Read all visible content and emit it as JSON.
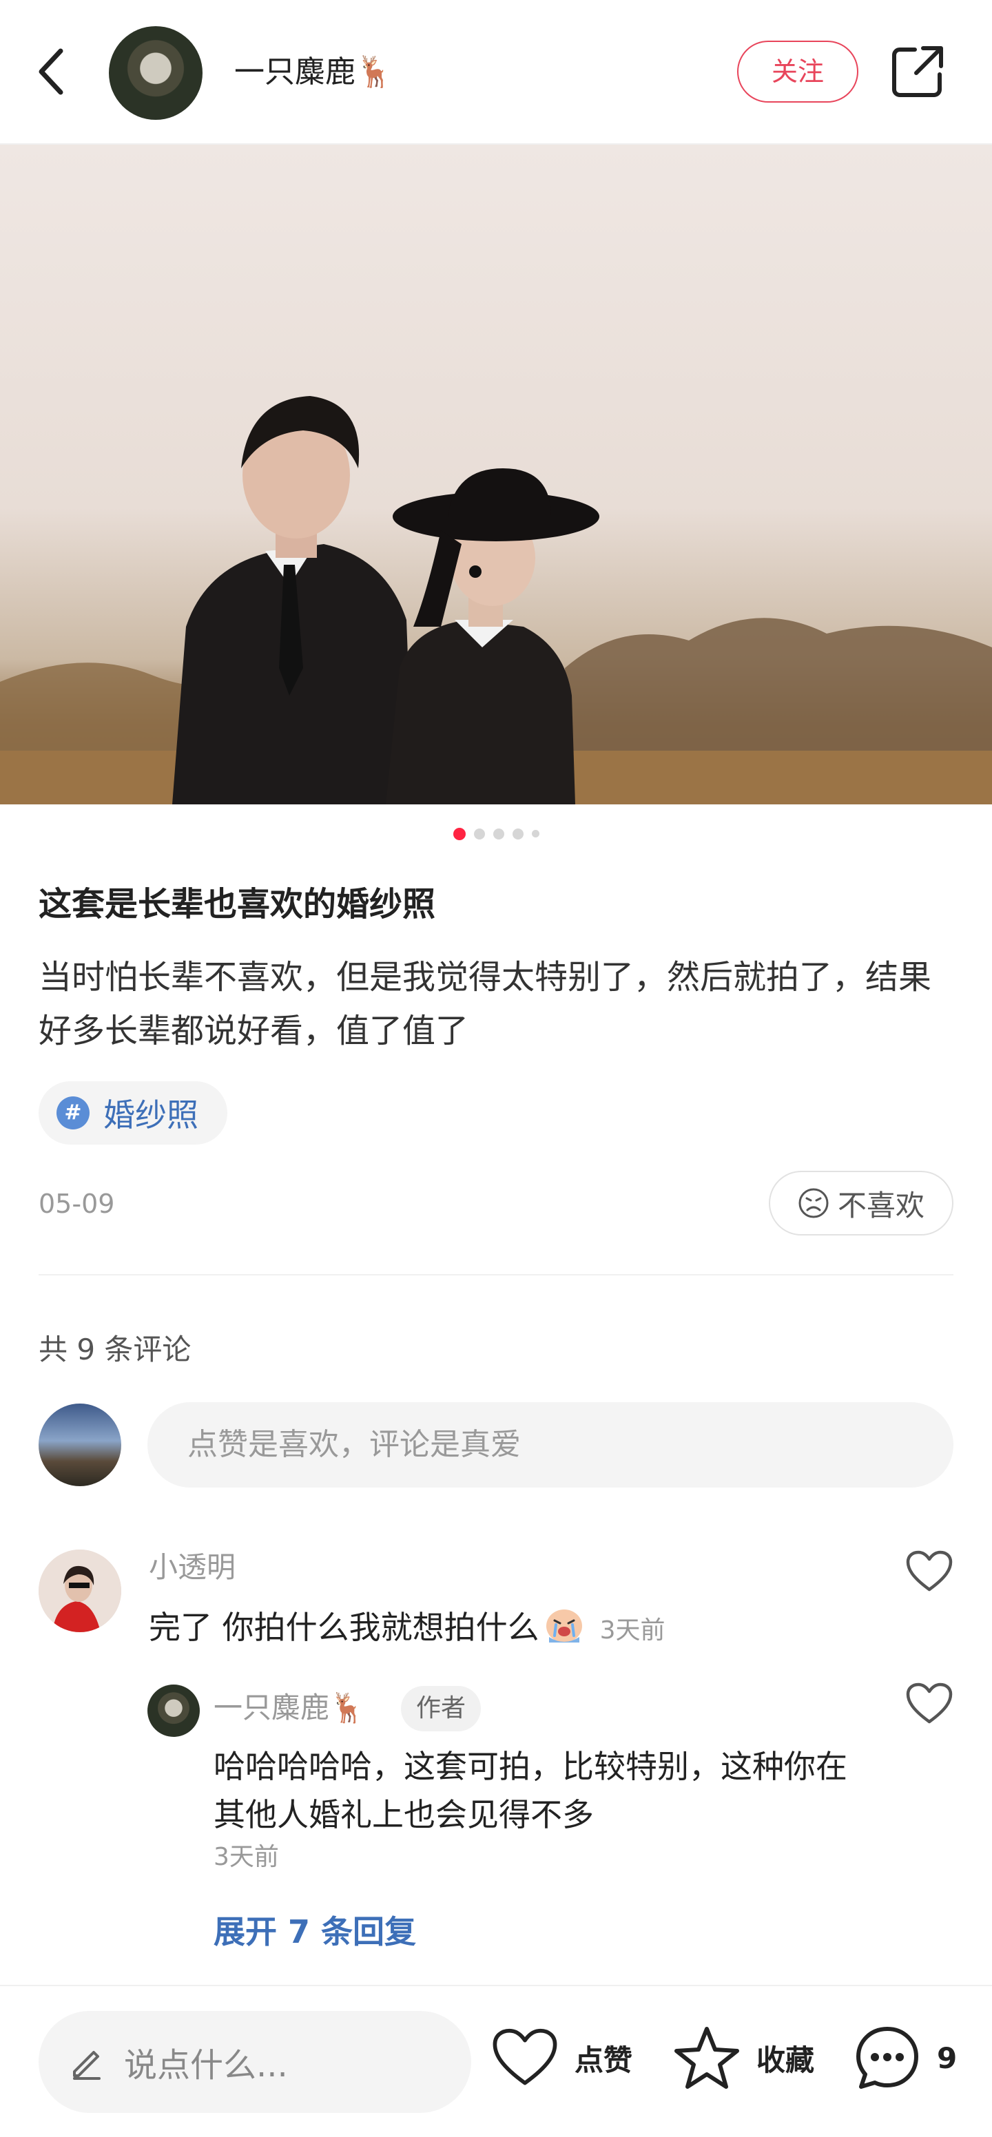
{
  "header": {
    "username": "一只麋鹿🦌",
    "follow_label": "关注"
  },
  "carousel": {
    "total": 5,
    "active_index": 1
  },
  "post": {
    "title": "这套是长辈也喜欢的婚纱照",
    "content": "当时怕长辈不喜欢，但是我觉得太特别了，然后就拍了，结果好多长辈都说好看，值了值了",
    "tag": "婚纱照",
    "date": "05-09",
    "dislike_label": "不喜欢"
  },
  "comments": {
    "count_label": "共 9 条评论",
    "input_placeholder": "点赞是喜欢，评论是真爱",
    "items": [
      {
        "name": "小透明",
        "text": "完了 你拍什么我就想拍什么",
        "time": "3天前",
        "reply": {
          "name": "一只麋鹿🦌",
          "badge": "作者",
          "text": "哈哈哈哈哈，这套可拍，比较特别，这种你在其他人婚礼上也会见得不多",
          "time": "3天前"
        },
        "expand_label": "展开 7 条回复"
      }
    ]
  },
  "bottom_bar": {
    "input_placeholder": "说点什么...",
    "like_label": "点赞",
    "collect_label": "收藏",
    "comment_count": "9"
  },
  "colors": {
    "accent": "#ff2442",
    "follow": "#e8455b",
    "link": "#3d6fb8"
  }
}
